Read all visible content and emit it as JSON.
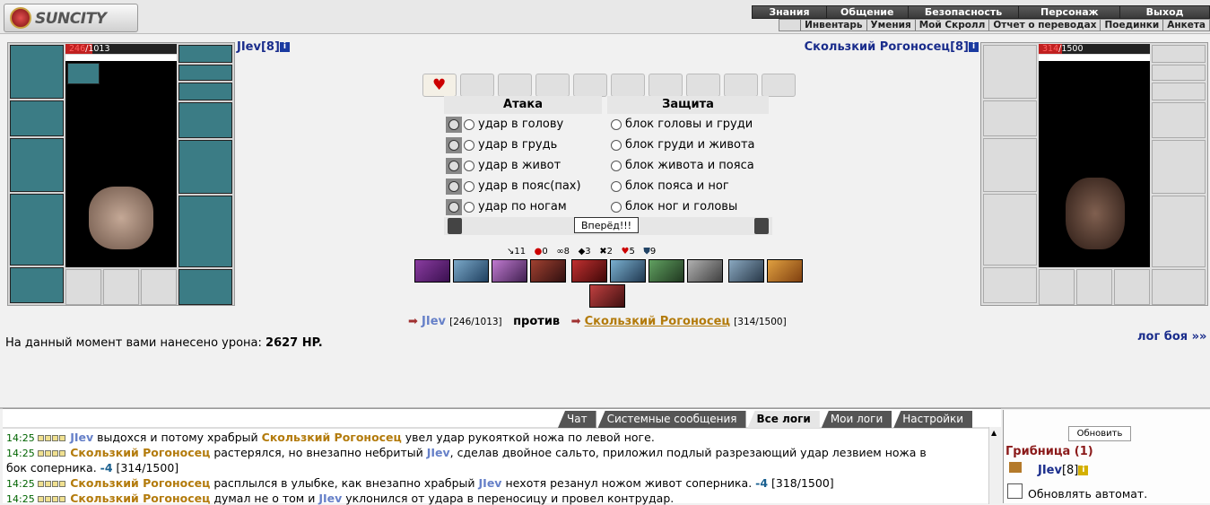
{
  "header": {
    "logo_text": "SUNCITY",
    "nav_top": [
      "Знания",
      "Общение",
      "Безопасность",
      "Персонаж",
      "Выход"
    ],
    "nav_sub": [
      "Инвентарь",
      "Умения",
      "Мой Скролл",
      "Отчет о переводах",
      "Поединки",
      "Анкета"
    ]
  },
  "player": {
    "name": "JIev",
    "level": "[8]",
    "hp": "246",
    "hp_max": "/1013",
    "hp_fraction": 0.243
  },
  "enemy": {
    "name": "Скользкий Рогоносец",
    "level": "[8]",
    "hp": "314",
    "hp_max": "/1500",
    "hp_fraction": 0.209
  },
  "battle": {
    "attack_header": "Атака",
    "defense_header": "Защита",
    "attacks": [
      "удар в голову",
      "удар в грудь",
      "удар в живот",
      "удар в пояс(пах)",
      "удар по ногам"
    ],
    "blocks": [
      "блок головы и груди",
      "блок груди и живота",
      "блок живота и пояса",
      "блок пояса и ног",
      "блок ног и головы"
    ],
    "go_button": "Вперёд!!!"
  },
  "stats": [
    {
      "icon": "sword-icon",
      "value": "11"
    },
    {
      "icon": "blood-drop-icon",
      "value": "0"
    },
    {
      "icon": "chain-icon",
      "value": "8"
    },
    {
      "icon": "shield-icon",
      "value": "3"
    },
    {
      "icon": "crossed-swords-icon",
      "value": "2"
    },
    {
      "icon": "heart-icon",
      "value": "5"
    },
    {
      "icon": "armor-icon",
      "value": "9"
    }
  ],
  "versus": {
    "left_name": "JIev",
    "left_hp": "[246/1013]",
    "word": "против",
    "right_name": "Скользкий Рогоносец",
    "right_hp": "[314/1500]"
  },
  "damage": {
    "label": "На данный момент вами нанесено урона:",
    "value": "2627 HP."
  },
  "battle_log_link": "лог боя »»",
  "tabs": [
    "Чат",
    "Системные сообщения",
    "Все логи",
    "Мои логи",
    "Настройки"
  ],
  "log": [
    {
      "time": "14:25",
      "parts": [
        {
          "t": "JIev",
          "c": "b"
        },
        {
          "t": " выдохся и потому храбрый ",
          "c": ""
        },
        {
          "t": "Скользкий Рогоносец",
          "c": "o"
        },
        {
          "t": " увел удар рукояткой ножа по левой ноге.",
          "c": ""
        }
      ]
    },
    {
      "time": "14:25",
      "parts": [
        {
          "t": "Скользкий Рогоносец",
          "c": "o"
        },
        {
          "t": " растерялся, но внезапно небритый ",
          "c": ""
        },
        {
          "t": "JIev",
          "c": "b"
        },
        {
          "t": ", сделав двойное сальто, приложил подлый разрезающий удар лезвием ножа в",
          "c": ""
        }
      ]
    },
    {
      "time": "",
      "parts": [
        {
          "t": "бок соперника. ",
          "c": ""
        },
        {
          "t": "-4",
          "c": "n"
        },
        {
          "t": " [314/1500]",
          "c": ""
        }
      ]
    },
    {
      "time": "14:25",
      "parts": [
        {
          "t": "Скользкий Рогоносец",
          "c": "o"
        },
        {
          "t": " расплылся в улыбке, как внезапно храбрый ",
          "c": ""
        },
        {
          "t": "JIev",
          "c": "b"
        },
        {
          "t": " нехотя резанул ножом живот соперника. ",
          "c": ""
        },
        {
          "t": "-4",
          "c": "n"
        },
        {
          "t": " [318/1500]",
          "c": ""
        }
      ]
    },
    {
      "time": "14:25",
      "parts": [
        {
          "t": "Скользкий Рогоносец",
          "c": "o"
        },
        {
          "t": " думал не о том и ",
          "c": ""
        },
        {
          "t": "JIev",
          "c": "b"
        },
        {
          "t": " уклонился от удара в переносицу и провел контрудар.",
          "c": ""
        }
      ]
    }
  ],
  "sidebar": {
    "refresh_button": "Обновить",
    "location": "Грибница (1)",
    "user_name": "JIev",
    "user_level": "[8]",
    "auto_refresh": "Обновлять автомат."
  }
}
